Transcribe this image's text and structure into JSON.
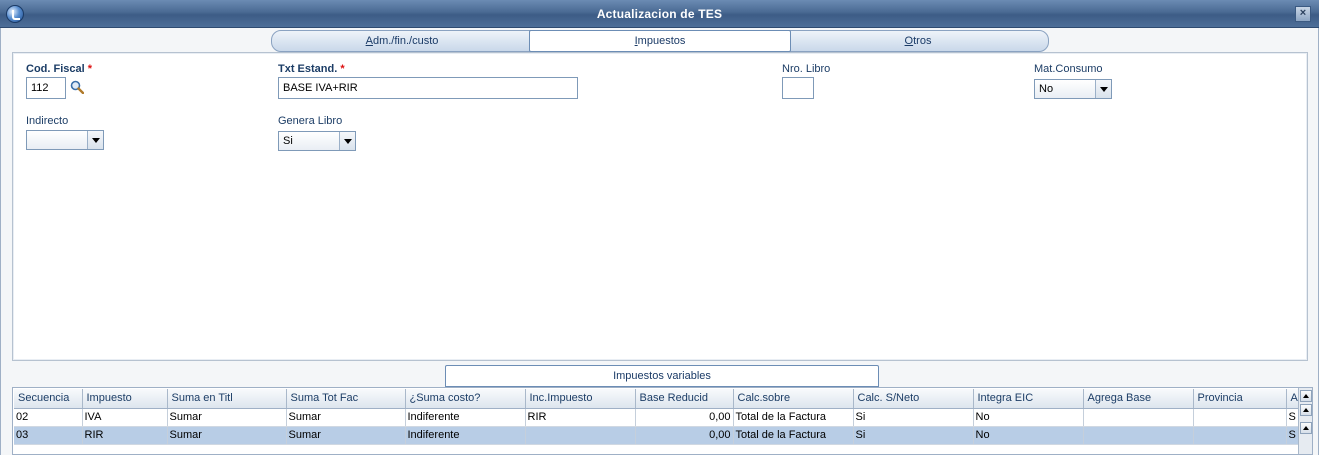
{
  "window": {
    "title": "Actualizacion de TES",
    "close_label": "×"
  },
  "tabs": [
    {
      "label": "Adm./fin./custo",
      "underline": "A",
      "rest": "dm./fin./custo"
    },
    {
      "label": "Impuestos",
      "underline": "I",
      "rest": "mpuestos"
    },
    {
      "label": "Otros",
      "underline": "O",
      "rest": "tros"
    }
  ],
  "form": {
    "cod_fiscal": {
      "label": "Cod. Fiscal",
      "required": "*",
      "value": "112"
    },
    "txt_estand": {
      "label": "Txt Estand.",
      "required": "*",
      "value": "BASE IVA+RIR"
    },
    "nro_libro": {
      "label": "Nro. Libro",
      "value": ""
    },
    "mat_consumo": {
      "label": "Mat.Consumo",
      "value": "No"
    },
    "indirecto": {
      "label": "Indirecto",
      "value": ""
    },
    "genera_libro": {
      "label": "Genera Libro",
      "value": "Si"
    }
  },
  "subtab": {
    "label": "Impuestos variables"
  },
  "grid": {
    "columns": [
      "Secuencia",
      "Impuesto",
      "Suma en Titl",
      "Suma Tot Fac",
      "¿Suma costo?",
      "Inc.Impuesto",
      "Base Reducid",
      "Calc.sobre",
      "Calc. S/Neto",
      "Integra EIC",
      "Agrega Base",
      "Provincia",
      "A"
    ],
    "rows": [
      [
        "02",
        "IVA",
        "Sumar",
        "Sumar",
        "Indiferente",
        "RIR",
        "0,00",
        "Total de la Factura",
        "Si",
        "No",
        "",
        "",
        "S"
      ],
      [
        "03",
        "RIR",
        "Sumar",
        "Sumar",
        "Indiferente",
        "",
        "0,00",
        "Total de la Factura",
        "Si",
        "No",
        "",
        "",
        "S"
      ]
    ]
  }
}
